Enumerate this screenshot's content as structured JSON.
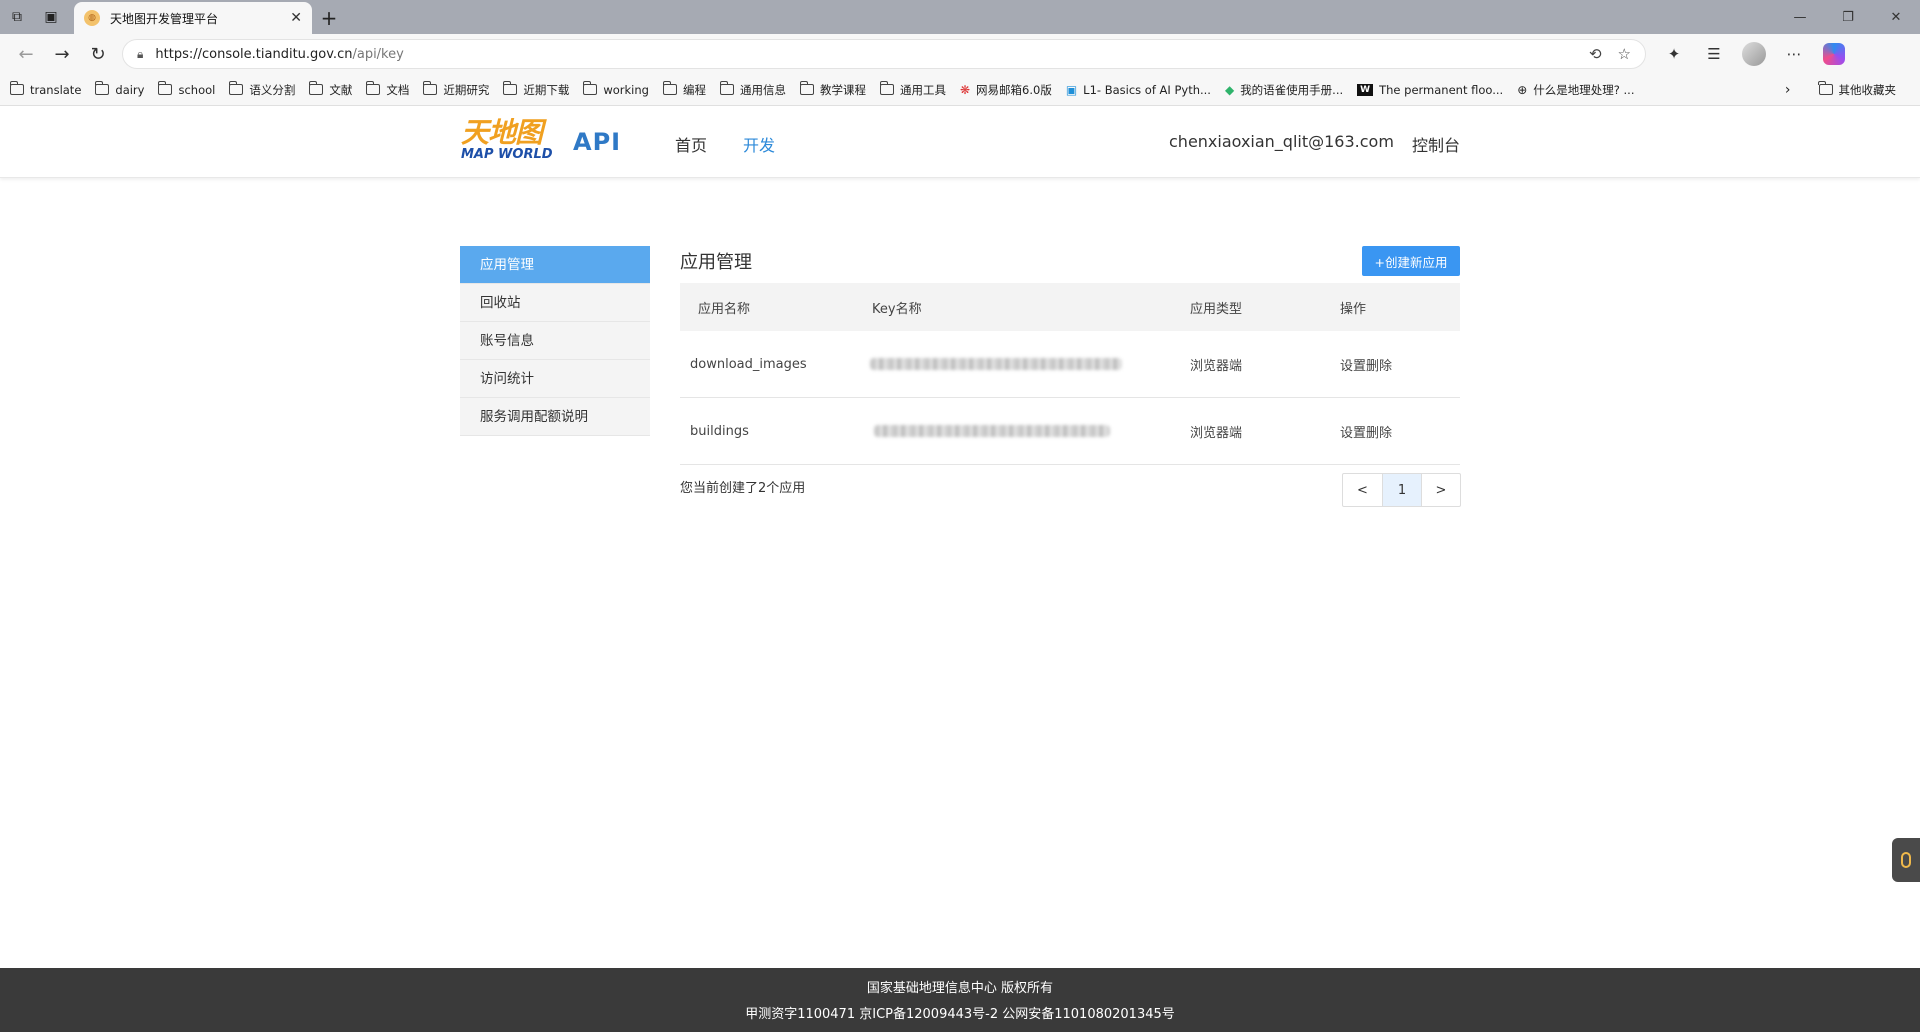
{
  "browser": {
    "tab_title": "天地图开发管理平台",
    "url_host": "https://console.tianditu.gov.cn",
    "url_path": "/api/key",
    "bookmarks": [
      "translate",
      "dairy",
      "school",
      "语义分割",
      "文献",
      "文档",
      "近期研究",
      "近期下载",
      "working",
      "编程",
      "通用信息",
      "教学课程",
      "通用工具"
    ],
    "bookmark_mail": "网易邮箱6.0版",
    "bookmark_ai": "L1- Basics of AI Pyth...",
    "bookmark_yuque": "我的语雀使用手册...",
    "bookmark_w": "The permanent floo...",
    "bookmark_geo": "什么是地理处理? ...",
    "bookmark_other": "其他收藏夹"
  },
  "header": {
    "logo_cn": "天地图",
    "logo_en": "MAP WORLD",
    "api_label": "API",
    "nav_home": "首页",
    "nav_dev": "开发",
    "user_email": "chenxiaoxian_qlit@163.com",
    "console": "控制台"
  },
  "sidebar": {
    "items": [
      {
        "label": "应用管理"
      },
      {
        "label": "回收站"
      },
      {
        "label": "账号信息"
      },
      {
        "label": "访问统计"
      },
      {
        "label": "服务调用配额说明"
      }
    ]
  },
  "main": {
    "title": "应用管理",
    "create_button": "+创建新应用",
    "columns": [
      "应用名称",
      "Key名称",
      "应用类型",
      "操作"
    ],
    "rows": [
      {
        "name": "download_images",
        "type": "浏览器端",
        "actions": "设置删除"
      },
      {
        "name": "buildings",
        "type": "浏览器端",
        "actions": "设置删除"
      }
    ],
    "summary": "您当前创建了2个应用",
    "pager": {
      "prev": "<",
      "current": "1",
      "next": ">"
    }
  },
  "footer": {
    "line1": "国家基础地理信息中心  版权所有",
    "line2": "甲测资字1100471  京ICP备12009443号-2  公网安备1101080201345号"
  },
  "colors": {
    "accent": "#3a96f2",
    "sidebar_active": "#5aa9ee",
    "footer_bg": "#3a3a3a"
  }
}
